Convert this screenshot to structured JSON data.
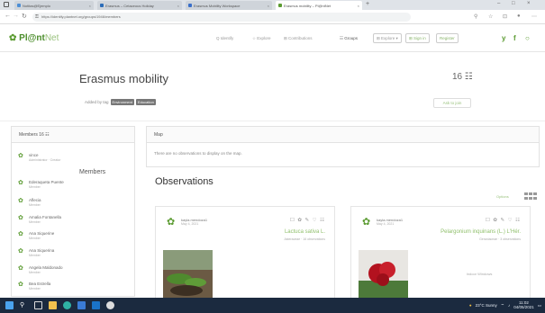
{
  "browser": {
    "tabs": [
      {
        "label": "Notitas@Ejemplo"
      },
      {
        "label": "Erasmus – Cetaceous Holiday"
      },
      {
        "label": "Erasmus Mobility Workspace"
      },
      {
        "label": "Erasmus mobility – Pl@ntNet"
      }
    ],
    "new_tab": "+",
    "url": "https://identify.plantnet.org/groups/1946/members"
  },
  "nav": {
    "logo_main": "Pl@nt",
    "logo_net": "Net",
    "links": [
      "Q Identify",
      "☆ Explore",
      "⊞ Contributions"
    ],
    "groups": "☷ Groups",
    "explore_btn": "⊞ Explore ▾",
    "signin_btn": "⊞ Sign in",
    "register_btn": "Register"
  },
  "group": {
    "title": "Erasmus mobility",
    "member_count": "16",
    "tag_prefix": "Added by tag",
    "tags": [
      "Environment",
      "Education"
    ],
    "join": "Ask to join"
  },
  "sidebar": {
    "header": "Members 16 ☷",
    "section": "Members",
    "members": [
      {
        "name": "vince",
        "role": "Administrator · Creator"
      },
      {
        "name": "Ederaqueta Puente",
        "role": "Member"
      },
      {
        "name": "Aflecia",
        "role": "Member"
      },
      {
        "name": "Amalia Fontanella",
        "role": "Member"
      },
      {
        "name": "Ana Siquerine",
        "role": "Member"
      },
      {
        "name": "Ana Siquerina",
        "role": "Member"
      },
      {
        "name": "Angela Maldonado",
        "role": "Member"
      },
      {
        "name": "Bea Estrella",
        "role": "Member"
      }
    ]
  },
  "map": {
    "header": "Map",
    "message": "There are no observations to display on the map."
  },
  "observations": {
    "title": "Observations",
    "view_label": "Options",
    "cards": [
      {
        "user": "kayla.mendoza1",
        "date": "May 4, 2021",
        "actions": "☐ ✿ ✎ ♡ ☷",
        "species": "Lactuca sativa L.",
        "family": "Asteraceae · 16 observations",
        "extra": ""
      },
      {
        "user": "kayla.mendoza1",
        "date": "May 4, 2021",
        "actions": "☐ ✿ ✎ ♡ ☷",
        "species": "Pelargonium inquinans (L.) L'Hér.",
        "family": "Geraniaceae · 3 observations",
        "extra": "Indoor Windows"
      }
    ]
  },
  "taskbar": {
    "weather": "23°C Sunny",
    "time": "11:02",
    "date": "04/05/2021"
  },
  "colors": {
    "brand_green": "#4a8c2a",
    "light_green": "#9ac27e",
    "taskbar": "#1b2a3f"
  }
}
